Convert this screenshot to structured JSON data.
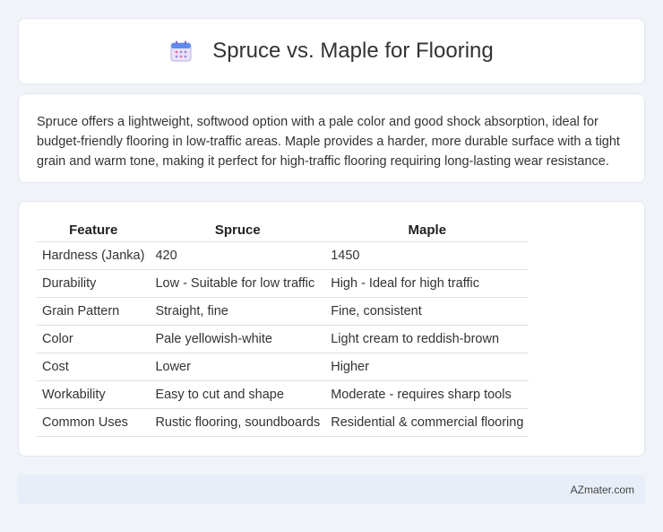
{
  "header": {
    "title": "Spruce vs. Maple for Flooring",
    "icon": "calendar-icon"
  },
  "description": "Spruce offers a lightweight, softwood option with a pale color and good shock absorption, ideal for budget-friendly flooring in low-traffic areas. Maple provides a harder, more durable surface with a tight grain and warm tone, making it perfect for high-traffic flooring requiring long-lasting wear resistance.",
  "table": {
    "headers": [
      "Feature",
      "Spruce",
      "Maple"
    ],
    "rows": [
      [
        "Hardness (Janka)",
        "420",
        "1450"
      ],
      [
        "Durability",
        "Low - Suitable for low traffic",
        "High - Ideal for high traffic"
      ],
      [
        "Grain Pattern",
        "Straight, fine",
        "Fine, consistent"
      ],
      [
        "Color",
        "Pale yellowish-white",
        "Light cream to reddish-brown"
      ],
      [
        "Cost",
        "Lower",
        "Higher"
      ],
      [
        "Workability",
        "Easy to cut and shape",
        "Moderate - requires sharp tools"
      ],
      [
        "Common Uses",
        "Rustic flooring, soundboards",
        "Residential & commercial flooring"
      ]
    ]
  },
  "footer": {
    "site": "AZmater.com"
  }
}
